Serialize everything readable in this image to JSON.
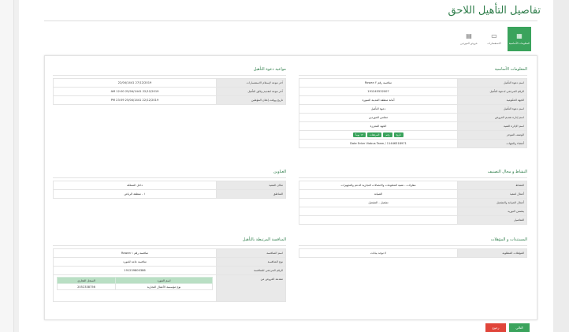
{
  "page": {
    "title": "تفاصيل التأهيل اللاحق"
  },
  "tabs": [
    {
      "label": "المعلومات الأساسية",
      "icon": "grid-icon",
      "active": true
    },
    {
      "label": "الاستفسارات",
      "icon": "chat-icon",
      "active": false
    },
    {
      "label": "عروض الموردين",
      "icon": "offers-icon",
      "active": false
    }
  ],
  "basic": {
    "title": "المعلومات الأساسية",
    "rows": [
      {
        "k": "اسم دعوة التأهيل",
        "v": "منافسة رقم ٢ Rowan"
      },
      {
        "k": "الرقم المرجعي لدعوة التأهيل",
        "v": "191245532007"
      },
      {
        "k": "الجهة الحكومية",
        "v": "أمانة منطقة المدينة المنورة"
      },
      {
        "k": "اسم دعوة التأهيل",
        "v": "دعوة التأهيل"
      },
      {
        "k": "اسم إدارة تقديم العروض",
        "v": "مجلس الموردين"
      },
      {
        "k": "اسم الإدارة الفنية",
        "v": "الجهة المعززة"
      },
      {
        "k": "الوصف الموجز",
        "v": ""
      },
      {
        "k": "أعضاء والجهات",
        "v": "Date Enter Viabus Team / 11446318971"
      }
    ],
    "chips": [
      "تاريخ",
      "رقم",
      "المرفقات",
      "١٢ يوماً"
    ]
  },
  "dates": {
    "title": "مواعيد دعوة التأهيل",
    "rows": [
      {
        "k": "آخر موعد لإستلام الاستفسارات",
        "v": "27/12/2019   22/04/1441"
      },
      {
        "k": "آخر موعد لتقديم وثائق التأهيل",
        "v": "22/12/2019   25/04/1441   12:00 AM"
      },
      {
        "k": "تاريخ ووقت إعلان المؤهلين",
        "v": "22/12/2019   25/04/1441   23:59 PM"
      }
    ]
  },
  "activity": {
    "title": "النشاط و مجال التصنيف",
    "rows": [
      {
        "k": "النشاط",
        "v": "مقاولات - تقنية المعلومات والاتصالات التجارية الدعم والتجهيزات"
      },
      {
        "k": "أعمال لتنفيذ",
        "v": "الصيانة"
      },
      {
        "k": "أعمال الصيانة والتشغيل",
        "v": "تشغيل - التشغيل"
      },
      {
        "k": "يتضمن التوريد",
        "v": ""
      },
      {
        "k": "التفاصيل",
        "v": ""
      }
    ]
  },
  "address": {
    "title": "العناوين",
    "rows": [
      {
        "k": "مكان التنفيذ",
        "v": "داخل المملكة"
      },
      {
        "k": "المناطق",
        "v": "١ - منطقة الرياض"
      }
    ]
  },
  "docs": {
    "title": "المستندات و المؤهلات",
    "rows": [
      {
        "k": "المؤهلات المطلوبة",
        "v": "لا توجد بيانات"
      }
    ]
  },
  "linked": {
    "title": "المنافسة المرتبطة بالتأهيل",
    "rows": [
      {
        "k": "اسم المنافسة",
        "v": "منافسة رقم ١ Rowan"
      },
      {
        "k": "نوع المنافسة",
        "v": "منافسة عامة للمورد"
      },
      {
        "k": "الرقم المرجعي للمنافسة",
        "v": "191239800386"
      }
    ],
    "suppliers_label": "مقدمة العروض من",
    "suppliers_headers": [
      "اسم المورد",
      "السجل التجاري"
    ],
    "suppliers": [
      {
        "name": "نوع مؤسسة الأعمال التجارية",
        "cr": "2052338756"
      }
    ]
  },
  "buttons": {
    "next": "التالي",
    "back": "رجوع"
  },
  "colors": {
    "accent": "#3aa35c",
    "title": "#2e7d4a",
    "danger": "#e0453a"
  }
}
